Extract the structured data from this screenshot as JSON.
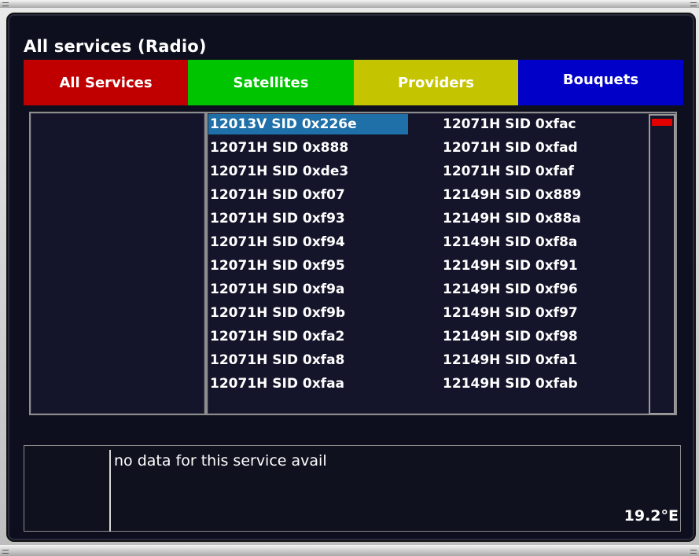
{
  "title": "All services (Radio)",
  "tabs": [
    {
      "label": "All Services",
      "color": "#c00000",
      "text_color": "#ffffff"
    },
    {
      "label": "Satellites",
      "color": "#00c400",
      "text_color": "#ffffff"
    },
    {
      "label": "Providers",
      "color": "#c4c400",
      "text_color": "#ffffff"
    },
    {
      "label": "Bouquets",
      "color": "#0000c8",
      "text_color": "#ffffff"
    }
  ],
  "services_col1": [
    "12013V SID 0x226e",
    "12071H SID 0x888",
    "12071H SID 0xde3",
    "12071H SID 0xf07",
    "12071H SID 0xf93",
    "12071H SID 0xf94",
    "12071H SID 0xf95",
    "12071H SID 0xf9a",
    "12071H SID 0xf9b",
    "12071H SID 0xfa2",
    "12071H SID 0xfa8",
    "12071H SID 0xfaa"
  ],
  "services_col2": [
    "12071H SID 0xfac",
    "12071H SID 0xfad",
    "12071H SID 0xfaf",
    "12149H SID 0x889",
    "12149H SID 0x88a",
    "12149H SID 0xf8a",
    "12149H SID 0xf91",
    "12149H SID 0xf96",
    "12149H SID 0xf97",
    "12149H SID 0xf98",
    "12149H SID 0xfa1",
    "12149H SID 0xfab"
  ],
  "selected_index": 0,
  "scroll_position": 0.0,
  "info": {
    "text": "no data for this service avail",
    "orbital": "19.2°E"
  }
}
